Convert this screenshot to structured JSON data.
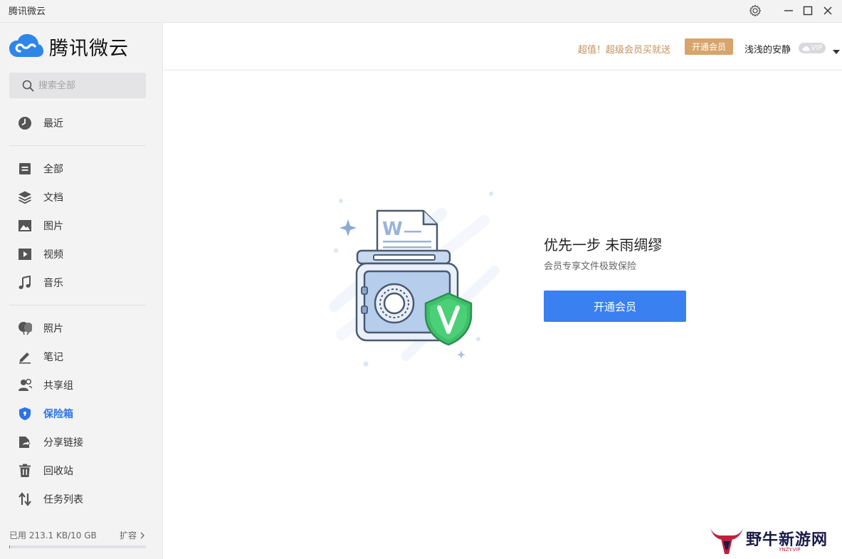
{
  "window": {
    "title": "腾讯微云"
  },
  "logo": {
    "text": "腾讯微云"
  },
  "search": {
    "placeholder": "搜索全部"
  },
  "nav": {
    "recent": "最近",
    "all": "全部",
    "docs": "文档",
    "images": "图片",
    "videos": "视频",
    "music": "音乐",
    "photos": "照片",
    "notes": "笔记",
    "share_group": "共享组",
    "safe": "保险箱",
    "share_links": "分享链接",
    "recycle": "回收站",
    "tasks": "任务列表"
  },
  "storage": {
    "used": "已用 213.1 KB/10 GB",
    "expand": "扩容",
    "fraction": 2e-05
  },
  "header": {
    "promo": "超值！超级会员买就送",
    "vip_button": "开通会员",
    "username": "浅浅的安静",
    "vip_badge": "VIP"
  },
  "main": {
    "slogan": "优先一步 未雨绸缪",
    "subtext": "会员专享文件极致保险",
    "button": "开通会员"
  },
  "watermark": {
    "text": "野牛新游网",
    "sub": "YNZY.VIP"
  },
  "colors": {
    "accent": "#2f74e6",
    "button": "#3a80f0",
    "gold": "#d7a46b",
    "shield": "#46c06a"
  }
}
